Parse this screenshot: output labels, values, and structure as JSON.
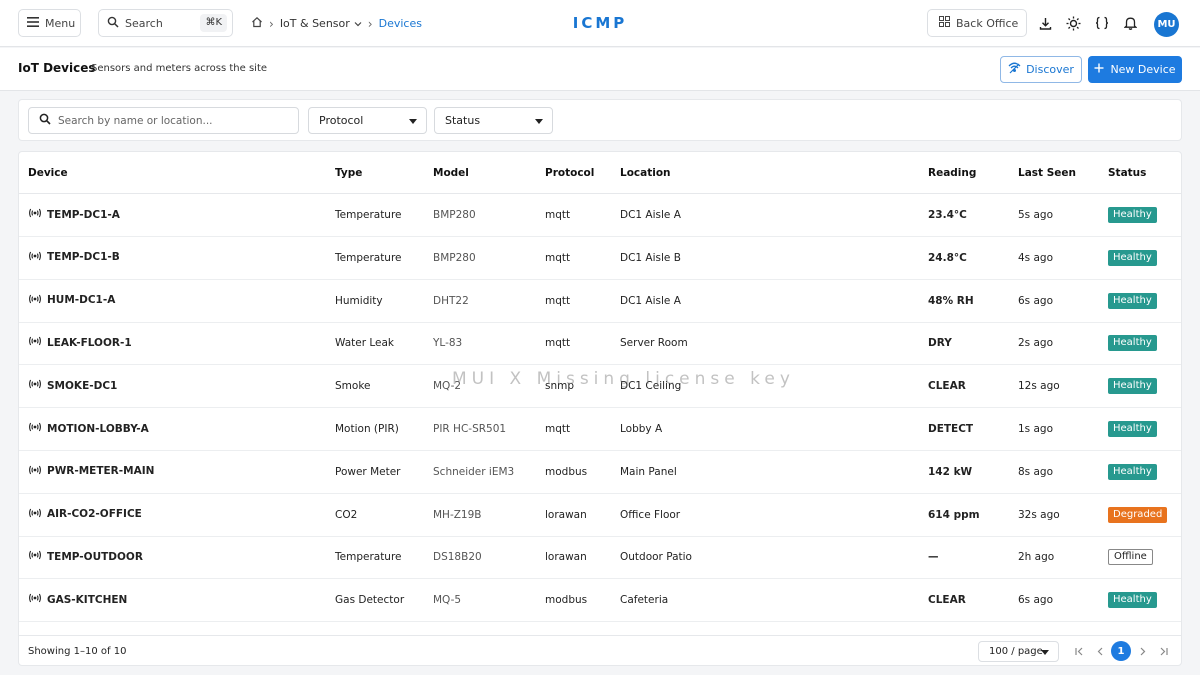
{
  "topbar": {
    "menu_label": "Menu",
    "search_label": "Search",
    "search_shortcut": "⌘K",
    "breadcrumb": {
      "section": "IoT & Sensor",
      "current": "Devices"
    },
    "brand": "ICMP",
    "back_office_label": "Back Office",
    "avatar_initials": "MU"
  },
  "page": {
    "title": "IoT Devices",
    "subtitle": "Sensors and meters across the site",
    "discover_label": "Discover",
    "new_device_label": "New Device"
  },
  "filters": {
    "search_placeholder": "Search by name or location...",
    "protocol_label": "Protocol",
    "status_label": "Status"
  },
  "table": {
    "columns": [
      "Device",
      "Type",
      "Model",
      "Protocol",
      "Location",
      "Reading",
      "Last Seen",
      "Status"
    ],
    "rows": [
      {
        "device": "TEMP-DC1-A",
        "type": "Temperature",
        "model": "BMP280",
        "protocol": "mqtt",
        "location": "DC1 Aisle A",
        "reading": "23.4°C",
        "last_seen": "5s ago",
        "status": "Healthy"
      },
      {
        "device": "TEMP-DC1-B",
        "type": "Temperature",
        "model": "BMP280",
        "protocol": "mqtt",
        "location": "DC1 Aisle B",
        "reading": "24.8°C",
        "last_seen": "4s ago",
        "status": "Healthy"
      },
      {
        "device": "HUM-DC1-A",
        "type": "Humidity",
        "model": "DHT22",
        "protocol": "mqtt",
        "location": "DC1 Aisle A",
        "reading": "48% RH",
        "last_seen": "6s ago",
        "status": "Healthy"
      },
      {
        "device": "LEAK-FLOOR-1",
        "type": "Water Leak",
        "model": "YL-83",
        "protocol": "mqtt",
        "location": "Server Room",
        "reading": "DRY",
        "last_seen": "2s ago",
        "status": "Healthy"
      },
      {
        "device": "SMOKE-DC1",
        "type": "Smoke",
        "model": "MQ-2",
        "protocol": "snmp",
        "location": "DC1 Ceiling",
        "reading": "CLEAR",
        "last_seen": "12s ago",
        "status": "Healthy"
      },
      {
        "device": "MOTION-LOBBY-A",
        "type": "Motion (PIR)",
        "model": "PIR HC-SR501",
        "protocol": "mqtt",
        "location": "Lobby A",
        "reading": "DETECT",
        "last_seen": "1s ago",
        "status": "Healthy"
      },
      {
        "device": "PWR-METER-MAIN",
        "type": "Power Meter",
        "model": "Schneider iEM3",
        "protocol": "modbus",
        "location": "Main Panel",
        "reading": "142 kW",
        "last_seen": "8s ago",
        "status": "Healthy"
      },
      {
        "device": "AIR-CO2-OFFICE",
        "type": "CO2",
        "model": "MH-Z19B",
        "protocol": "lorawan",
        "location": "Office Floor",
        "reading": "614 ppm",
        "last_seen": "32s ago",
        "status": "Degraded"
      },
      {
        "device": "TEMP-OUTDOOR",
        "type": "Temperature",
        "model": "DS18B20",
        "protocol": "lorawan",
        "location": "Outdoor Patio",
        "reading": "—",
        "last_seen": "2h ago",
        "status": "Offline"
      },
      {
        "device": "GAS-KITCHEN",
        "type": "Gas Detector",
        "model": "MQ-5",
        "protocol": "modbus",
        "location": "Cafeteria",
        "reading": "CLEAR",
        "last_seen": "6s ago",
        "status": "Healthy"
      }
    ]
  },
  "footer": {
    "showing": "Showing 1–10 of 10",
    "per_page": "100 / page",
    "current_page": "1"
  },
  "watermark": "MUI X Missing license key",
  "colors": {
    "accent": "#1976d2",
    "healthy": "#27998f",
    "degraded": "#e8731e"
  }
}
